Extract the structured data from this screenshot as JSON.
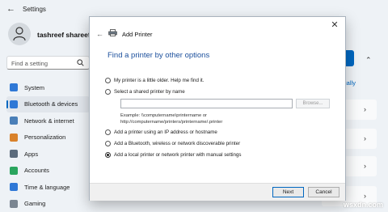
{
  "settings": {
    "app_title": "Settings",
    "user_name": "tashreef shareef",
    "search_placeholder": "Find a setting",
    "nav": [
      {
        "label": "System",
        "color": "#2f78d6",
        "icon": "monitor-icon"
      },
      {
        "label": "Bluetooth & devices",
        "color": "#2f78d6",
        "icon": "bluetooth-icon",
        "selected": true
      },
      {
        "label": "Network & internet",
        "color": "#4a7fb8",
        "icon": "wifi-icon"
      },
      {
        "label": "Personalization",
        "color": "#d9822b",
        "icon": "brush-icon"
      },
      {
        "label": "Apps",
        "color": "#5b6b7c",
        "icon": "apps-icon"
      },
      {
        "label": "Accounts",
        "color": "#2aa55e",
        "icon": "person-icon"
      },
      {
        "label": "Time & language",
        "color": "#2f78d6",
        "icon": "globe-clock-icon"
      },
      {
        "label": "Gaming",
        "color": "#7a8591",
        "icon": "gamepad-icon"
      }
    ],
    "page_heading_fragment": "ers",
    "manually_link_fragment": "nanually"
  },
  "dialog": {
    "title": "Add Printer",
    "heading": "Find a printer by other options",
    "options": [
      {
        "label": "My printer is a little older. Help me find it.",
        "selected": false
      },
      {
        "label": "Select a shared printer by name",
        "selected": false
      },
      {
        "label": "Add a printer using an IP address or hostname",
        "selected": false
      },
      {
        "label": "Add a Bluetooth, wireless or network discoverable printer",
        "selected": false
      },
      {
        "label": "Add a local printer or network printer with manual settings",
        "selected": true
      }
    ],
    "shared_printer_value": "",
    "browse_label": "Browse...",
    "example_line1": "Example: \\\\computername\\printername or",
    "example_line2": "http://computername/printers/printername/.printer",
    "next_label": "Next",
    "cancel_label": "Cancel"
  },
  "watermark": "wsxdn.com",
  "colors": {
    "accent": "#0067c0",
    "heading_blue": "#1b4f9c"
  }
}
